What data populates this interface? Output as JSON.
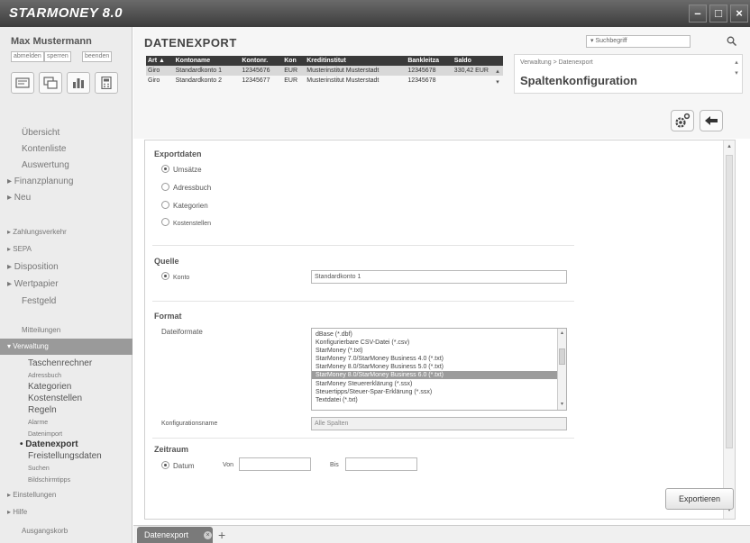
{
  "app": {
    "title": "STARMONEY 8.0",
    "window_controls": {
      "minimize": "–",
      "maximize": "□",
      "close": "×"
    }
  },
  "sidebar": {
    "user_name": "Max Mustermann",
    "user_links": [
      "abmelden",
      "sperren",
      "beenden"
    ],
    "tool_buttons": [
      {
        "icon": "accounts-icon"
      },
      {
        "icon": "transfer-icon"
      },
      {
        "icon": "chart-icon"
      },
      {
        "icon": "calculator-icon"
      }
    ],
    "nav": {
      "uebersicht": "Übersicht",
      "kontenliste": "Kontenliste",
      "auswertung": "Auswertung",
      "finanzplanung": "▸ Finanzplanung",
      "neu": "▸ Neu",
      "zahlungsverkehr": "▸ Zahlungsverkehr",
      "sepa": "▸ SEPA",
      "disposition": "▸ Disposition",
      "wertpapier": "▸ Wertpapier",
      "festgeld": "Festgeld",
      "mitteilungen": "Mitteilungen",
      "verwaltung": "▾ Verwaltung",
      "einstellungen": "▸ Einstellungen",
      "hilfe": "▸ Hilfe",
      "ausgangskorb": "Ausgangskorb"
    },
    "verwaltung_items": {
      "taschenrechner": "Taschenrechner",
      "adressbuch": "Adressbuch",
      "kategorien": "Kategorien",
      "kostenstellen": "Kostenstellen",
      "regeln": "Regeln",
      "alarme": "Alarme",
      "datenimport": "Datenimport",
      "datenexport": "• Datenexport",
      "freistellungsdaten": "Freistellungsdaten",
      "suchen": "Suchen",
      "bildschirmtipps": "Bildschirmtipps"
    }
  },
  "header": {
    "page_title": "DATENEXPORT",
    "search_placeholder": "▾ Suchbegriff"
  },
  "accounts_table": {
    "columns": [
      "Art ▲",
      "Kontoname",
      "Kontonr.",
      "Kon",
      "Kreditinstitut",
      "Bankleitza",
      "Saldo"
    ],
    "rows": [
      [
        "Giro",
        "Standardkonto 1",
        "12345676",
        "EUR",
        "Musterinstitut Musterstadt",
        "12345678",
        "330,42 EUR"
      ],
      [
        "Giro",
        "Standardkonto 2",
        "12345677",
        "EUR",
        "Musterinstitut Musterstadt",
        "12345678",
        ""
      ]
    ],
    "scroll": {
      "up": "▴",
      "down": "▾"
    }
  },
  "right_panel": {
    "breadcrumb": "Verwaltung > Datenexport",
    "title": "Spaltenkonfiguration"
  },
  "exportdaten": {
    "title": "Exportdaten",
    "options": [
      {
        "label": "Umsätze",
        "selected": true
      },
      {
        "label": "Adressbuch",
        "selected": false
      },
      {
        "label": "Kategorien",
        "selected": false
      },
      {
        "label": "Kostenstellen",
        "selected": false
      }
    ]
  },
  "quelle": {
    "title": "Quelle",
    "option": "Konto",
    "value": "Standardkonto 1"
  },
  "format": {
    "title": "Format",
    "dateiformate_label": "Dateiformate",
    "options": [
      "dBase (*.dbf)",
      "Konfigurierbare CSV-Datei (*.csv)",
      "StarMoney (*.txt)",
      "StarMoney 7.0/StarMoney Business 4.0 (*.txt)",
      "StarMoney 8.0/StarMoney Business 5.0 (*.txt)",
      "StarMoney 8.0/StarMoney Business 6.0 (*.txt)",
      "StarMoney Steuererklärung (*.ssx)",
      "Steuertipps/Steuer-Spar-Erklärung (*.ssx)",
      "Textdatei (*.txt)"
    ],
    "selected_index": 5,
    "konfig_label": "Konfigurationsname",
    "konfig_value": "Alle Spalten"
  },
  "zeitraum": {
    "title": "Zeitraum",
    "option": "Datum",
    "von_label": "Von",
    "von_value": "",
    "bis_label": "Bis",
    "bis_value": ""
  },
  "buttons": {
    "export": "Exportieren"
  },
  "tabs": [
    {
      "label": "Datenexport"
    }
  ],
  "tab_add": "+",
  "colors": {
    "titlebar": "#4a4a4a",
    "active_nav": "#9a9a9a",
    "table_header": "#3a3a3a"
  }
}
